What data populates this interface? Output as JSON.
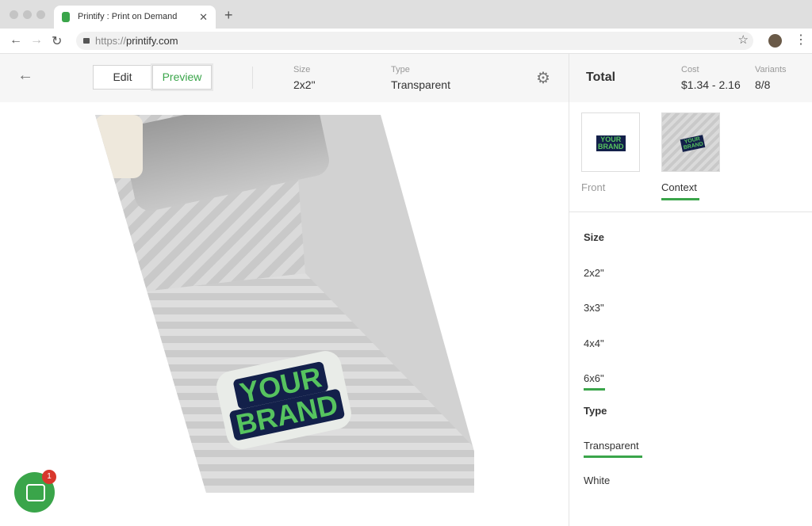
{
  "browser": {
    "tab_title": "Printify : Print on Demand",
    "url_protocol": "https://",
    "url_host": "printify.com"
  },
  "toolbar": {
    "edit_label": "Edit",
    "preview_label": "Preview",
    "size_label": "Size",
    "size_value": "2x2\"",
    "type_label": "Type",
    "type_value": "Transparent"
  },
  "preview": {
    "sticker_line1": "YOUR",
    "sticker_line2": "BRAND"
  },
  "chat": {
    "badge_count": "1"
  },
  "sidebar": {
    "total_label": "Total",
    "cost_label": "Cost",
    "cost_value": "$1.34 - 2.16",
    "variants_label": "Variants",
    "variants_value": "8/8",
    "views": [
      {
        "label": "Front",
        "active": false
      },
      {
        "label": "Context",
        "active": true
      }
    ],
    "size_heading": "Size",
    "sizes": [
      {
        "label": "2x2\"",
        "selected": false
      },
      {
        "label": "3x3\"",
        "selected": false
      },
      {
        "label": "4x4\"",
        "selected": false
      },
      {
        "label": "6x6\"",
        "selected": true
      }
    ],
    "type_heading": "Type",
    "types": [
      {
        "label": "Transparent",
        "selected": true
      },
      {
        "label": "White",
        "selected": false
      }
    ]
  },
  "colors": {
    "accent": "#3aa54a",
    "sticker_bg": "#13204a",
    "sticker_text": "#56c35f"
  }
}
